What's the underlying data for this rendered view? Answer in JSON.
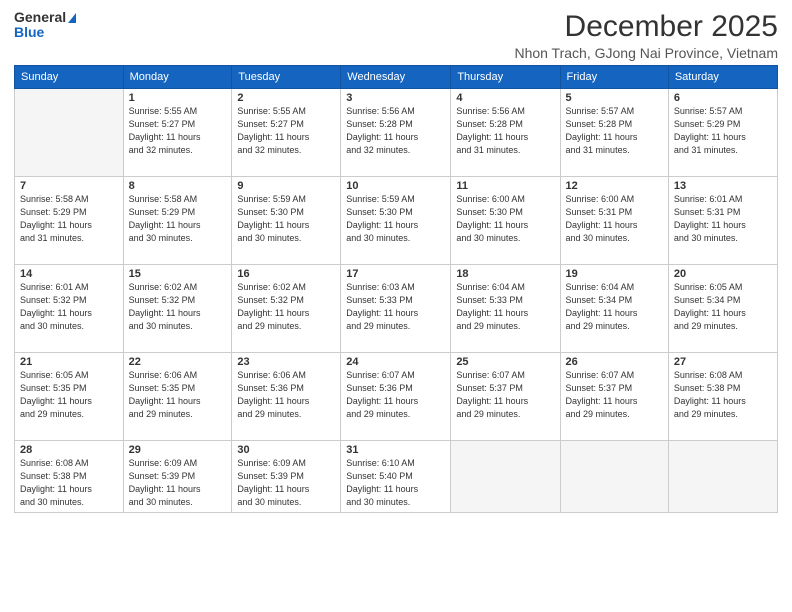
{
  "header": {
    "logo_line1": "General",
    "logo_line2": "Blue",
    "month_title": "December 2025",
    "location": "Nhon Trach, GJong Nai Province, Vietnam"
  },
  "days_of_week": [
    "Sunday",
    "Monday",
    "Tuesday",
    "Wednesday",
    "Thursday",
    "Friday",
    "Saturday"
  ],
  "weeks": [
    [
      {
        "day": "",
        "info": ""
      },
      {
        "day": "1",
        "info": "Sunrise: 5:55 AM\nSunset: 5:27 PM\nDaylight: 11 hours\nand 32 minutes."
      },
      {
        "day": "2",
        "info": "Sunrise: 5:55 AM\nSunset: 5:27 PM\nDaylight: 11 hours\nand 32 minutes."
      },
      {
        "day": "3",
        "info": "Sunrise: 5:56 AM\nSunset: 5:28 PM\nDaylight: 11 hours\nand 32 minutes."
      },
      {
        "day": "4",
        "info": "Sunrise: 5:56 AM\nSunset: 5:28 PM\nDaylight: 11 hours\nand 31 minutes."
      },
      {
        "day": "5",
        "info": "Sunrise: 5:57 AM\nSunset: 5:28 PM\nDaylight: 11 hours\nand 31 minutes."
      },
      {
        "day": "6",
        "info": "Sunrise: 5:57 AM\nSunset: 5:29 PM\nDaylight: 11 hours\nand 31 minutes."
      }
    ],
    [
      {
        "day": "7",
        "info": "Sunrise: 5:58 AM\nSunset: 5:29 PM\nDaylight: 11 hours\nand 31 minutes."
      },
      {
        "day": "8",
        "info": "Sunrise: 5:58 AM\nSunset: 5:29 PM\nDaylight: 11 hours\nand 30 minutes."
      },
      {
        "day": "9",
        "info": "Sunrise: 5:59 AM\nSunset: 5:30 PM\nDaylight: 11 hours\nand 30 minutes."
      },
      {
        "day": "10",
        "info": "Sunrise: 5:59 AM\nSunset: 5:30 PM\nDaylight: 11 hours\nand 30 minutes."
      },
      {
        "day": "11",
        "info": "Sunrise: 6:00 AM\nSunset: 5:30 PM\nDaylight: 11 hours\nand 30 minutes."
      },
      {
        "day": "12",
        "info": "Sunrise: 6:00 AM\nSunset: 5:31 PM\nDaylight: 11 hours\nand 30 minutes."
      },
      {
        "day": "13",
        "info": "Sunrise: 6:01 AM\nSunset: 5:31 PM\nDaylight: 11 hours\nand 30 minutes."
      }
    ],
    [
      {
        "day": "14",
        "info": "Sunrise: 6:01 AM\nSunset: 5:32 PM\nDaylight: 11 hours\nand 30 minutes."
      },
      {
        "day": "15",
        "info": "Sunrise: 6:02 AM\nSunset: 5:32 PM\nDaylight: 11 hours\nand 30 minutes."
      },
      {
        "day": "16",
        "info": "Sunrise: 6:02 AM\nSunset: 5:32 PM\nDaylight: 11 hours\nand 29 minutes."
      },
      {
        "day": "17",
        "info": "Sunrise: 6:03 AM\nSunset: 5:33 PM\nDaylight: 11 hours\nand 29 minutes."
      },
      {
        "day": "18",
        "info": "Sunrise: 6:04 AM\nSunset: 5:33 PM\nDaylight: 11 hours\nand 29 minutes."
      },
      {
        "day": "19",
        "info": "Sunrise: 6:04 AM\nSunset: 5:34 PM\nDaylight: 11 hours\nand 29 minutes."
      },
      {
        "day": "20",
        "info": "Sunrise: 6:05 AM\nSunset: 5:34 PM\nDaylight: 11 hours\nand 29 minutes."
      }
    ],
    [
      {
        "day": "21",
        "info": "Sunrise: 6:05 AM\nSunset: 5:35 PM\nDaylight: 11 hours\nand 29 minutes."
      },
      {
        "day": "22",
        "info": "Sunrise: 6:06 AM\nSunset: 5:35 PM\nDaylight: 11 hours\nand 29 minutes."
      },
      {
        "day": "23",
        "info": "Sunrise: 6:06 AM\nSunset: 5:36 PM\nDaylight: 11 hours\nand 29 minutes."
      },
      {
        "day": "24",
        "info": "Sunrise: 6:07 AM\nSunset: 5:36 PM\nDaylight: 11 hours\nand 29 minutes."
      },
      {
        "day": "25",
        "info": "Sunrise: 6:07 AM\nSunset: 5:37 PM\nDaylight: 11 hours\nand 29 minutes."
      },
      {
        "day": "26",
        "info": "Sunrise: 6:07 AM\nSunset: 5:37 PM\nDaylight: 11 hours\nand 29 minutes."
      },
      {
        "day": "27",
        "info": "Sunrise: 6:08 AM\nSunset: 5:38 PM\nDaylight: 11 hours\nand 29 minutes."
      }
    ],
    [
      {
        "day": "28",
        "info": "Sunrise: 6:08 AM\nSunset: 5:38 PM\nDaylight: 11 hours\nand 30 minutes."
      },
      {
        "day": "29",
        "info": "Sunrise: 6:09 AM\nSunset: 5:39 PM\nDaylight: 11 hours\nand 30 minutes."
      },
      {
        "day": "30",
        "info": "Sunrise: 6:09 AM\nSunset: 5:39 PM\nDaylight: 11 hours\nand 30 minutes."
      },
      {
        "day": "31",
        "info": "Sunrise: 6:10 AM\nSunset: 5:40 PM\nDaylight: 11 hours\nand 30 minutes."
      },
      {
        "day": "",
        "info": ""
      },
      {
        "day": "",
        "info": ""
      },
      {
        "day": "",
        "info": ""
      }
    ]
  ]
}
